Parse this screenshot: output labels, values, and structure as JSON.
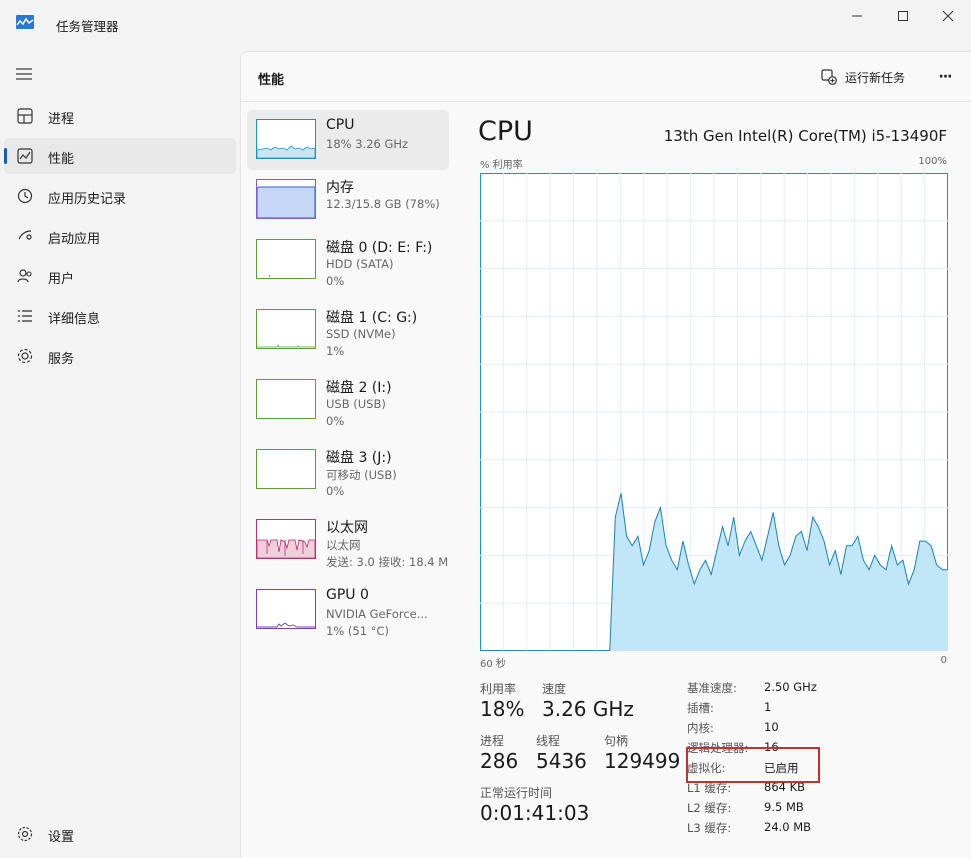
{
  "app": {
    "title": "任务管理器"
  },
  "sidebar": {
    "items": [
      {
        "label": "进程",
        "icon": "processes-icon"
      },
      {
        "label": "性能",
        "icon": "performance-icon",
        "active": true
      },
      {
        "label": "应用历史记录",
        "icon": "history-icon"
      },
      {
        "label": "启动应用",
        "icon": "startup-icon"
      },
      {
        "label": "用户",
        "icon": "users-icon"
      },
      {
        "label": "详细信息",
        "icon": "details-icon"
      },
      {
        "label": "服务",
        "icon": "services-icon"
      }
    ],
    "settings_label": "设置"
  },
  "header": {
    "title": "性能",
    "run_task_label": "运行新任务",
    "more_label": "···"
  },
  "devices": [
    {
      "name": "CPU",
      "sub1": "18% 3.26 GHz",
      "sub2": ""
    },
    {
      "name": "内存",
      "sub1": "12.3/15.8 GB (78%)",
      "sub2": ""
    },
    {
      "name": "磁盘 0 (D: E: F:)",
      "sub1": "HDD (SATA)",
      "sub2": "0%"
    },
    {
      "name": "磁盘 1 (C: G:)",
      "sub1": "SSD (NVMe)",
      "sub2": "1%"
    },
    {
      "name": "磁盘 2 (I:)",
      "sub1": "USB (USB)",
      "sub2": "0%"
    },
    {
      "name": "磁盘 3 (J:)",
      "sub1": "可移动 (USB)",
      "sub2": "0%"
    },
    {
      "name": "以太网",
      "sub1": "以太网",
      "sub2": "发送: 3.0 接收: 18.4 M"
    },
    {
      "name": "GPU 0",
      "sub1": "NVIDIA GeForce...",
      "sub2": "1% (51 °C)"
    }
  ],
  "detail": {
    "title": "CPU",
    "model": "13th Gen Intel(R) Core(TM) i5-13490F",
    "graph": {
      "ylabel": "% 利用率",
      "ymax": "100%",
      "xleft": "60 秒",
      "xright": "0"
    },
    "stats": {
      "utilization_label": "利用率",
      "utilization": "18%",
      "speed_label": "速度",
      "speed": "3.26 GHz",
      "processes_label": "进程",
      "processes": "286",
      "threads_label": "线程",
      "threads": "5436",
      "handles_label": "句柄",
      "handles": "129499",
      "uptime_label": "正常运行时间",
      "uptime": "0:01:41:03"
    },
    "specs": [
      {
        "k": "基准速度:",
        "v": "2.50 GHz"
      },
      {
        "k": "插槽:",
        "v": "1"
      },
      {
        "k": "内核:",
        "v": "10"
      },
      {
        "k": "逻辑处理器:",
        "v": "16"
      },
      {
        "k": "虚拟化:",
        "v": "已启用"
      },
      {
        "k": "L1 缓存:",
        "v": "864 KB"
      },
      {
        "k": "L2 缓存:",
        "v": "9.5 MB"
      },
      {
        "k": "L3 缓存:",
        "v": "24.0 MB"
      }
    ]
  },
  "chart_data": {
    "type": "area",
    "ylabel": "% 利用率",
    "ylim": [
      0,
      100
    ],
    "xlim": [
      60,
      0
    ],
    "series": [
      {
        "values": [
          0,
          0,
          0,
          0,
          0,
          0,
          0,
          0,
          0,
          0,
          0,
          0,
          0,
          0,
          0,
          0,
          0,
          0,
          0,
          0,
          0,
          0,
          0,
          0,
          28,
          33,
          24,
          22,
          24,
          18,
          21,
          27,
          30,
          22,
          19,
          17,
          23,
          18,
          14,
          17,
          19,
          16,
          21,
          26,
          22,
          28,
          20,
          23,
          25,
          22,
          19,
          24,
          29,
          22,
          18,
          20,
          24,
          25,
          21,
          28,
          26,
          23,
          18,
          21,
          16,
          22,
          22,
          24,
          19,
          17,
          20,
          18,
          17,
          22,
          18,
          19,
          14,
          17,
          23,
          23,
          22,
          18,
          17,
          17
        ]
      }
    ]
  }
}
